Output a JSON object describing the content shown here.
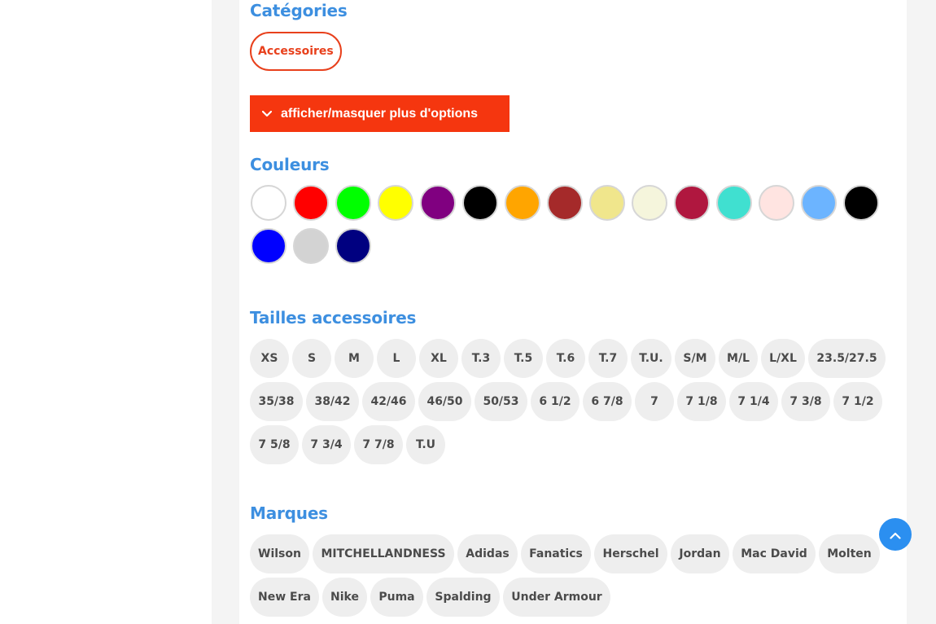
{
  "categories": {
    "title": "Catégories",
    "items": [
      "Accessoires"
    ]
  },
  "toggle": {
    "label": "afficher/masquer plus d'options",
    "icon": "chevron-down-icon"
  },
  "colors": {
    "title": "Couleurs",
    "swatches": [
      "#ffffff",
      "#ff0000",
      "#00ff00",
      "#ffff00",
      "#800080",
      "#000000",
      "#ffa500",
      "#a52a2a",
      "#f0e68c",
      "#f5f5dc",
      "#b0173f",
      "#40e0d0",
      "#ffe4e1",
      "#6cb4ff",
      "#000000",
      "#0000ff",
      "#d3d3d3",
      "#000080"
    ]
  },
  "sizes": {
    "title": "Tailles accessoires",
    "items": [
      "XS",
      "S",
      "M",
      "L",
      "XL",
      "T.3",
      "T.5",
      "T.6",
      "T.7",
      "T.U.",
      "S/M",
      "M/L",
      "L/XL",
      "23.5/27.5",
      "35/38",
      "38/42",
      "42/46",
      "46/50",
      "50/53",
      "6 1/2",
      "6 7/8",
      "7",
      "7 1/8",
      "7 1/4",
      "7 3/8",
      "7 1/2",
      "7 5/8",
      "7 3/4",
      "7 7/8",
      "T.U"
    ]
  },
  "brands": {
    "title": "Marques",
    "items": [
      "Wilson",
      "MITCHELLANDNESS",
      "Adidas",
      "Fanatics",
      "Herschel",
      "Jordan",
      "Mac David",
      "Molten",
      "New Era",
      "Nike",
      "Puma",
      "Spalding",
      "Under Armour"
    ]
  },
  "back_to_top_icon": "chevron-up-icon"
}
